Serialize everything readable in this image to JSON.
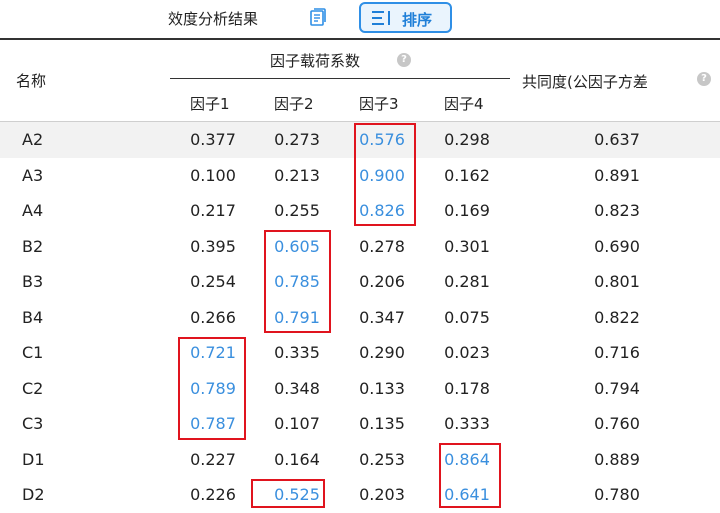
{
  "toolbar": {
    "title": "效度分析结果",
    "copy_icon": "document-copy-icon",
    "sort_label": "排序",
    "sort_icon": "sort-icon"
  },
  "table": {
    "header": {
      "name": "名称",
      "loadings_group": "因子载荷系数",
      "factors": [
        "因子1",
        "因子2",
        "因子3",
        "因子4"
      ],
      "communality": "共同度(公因子方差",
      "help_mark": "?"
    },
    "rows": [
      {
        "name": "A2",
        "values": [
          "0.377",
          "0.273",
          "0.576",
          "0.298",
          "0.637"
        ]
      },
      {
        "name": "A3",
        "values": [
          "0.100",
          "0.213",
          "0.900",
          "0.162",
          "0.891"
        ]
      },
      {
        "name": "A4",
        "values": [
          "0.217",
          "0.255",
          "0.826",
          "0.169",
          "0.823"
        ]
      },
      {
        "name": "B2",
        "values": [
          "0.395",
          "0.605",
          "0.278",
          "0.301",
          "0.690"
        ]
      },
      {
        "name": "B3",
        "values": [
          "0.254",
          "0.785",
          "0.206",
          "0.281",
          "0.801"
        ]
      },
      {
        "name": "B4",
        "values": [
          "0.266",
          "0.791",
          "0.347",
          "0.075",
          "0.822"
        ]
      },
      {
        "name": "C1",
        "values": [
          "0.721",
          "0.335",
          "0.290",
          "0.023",
          "0.716"
        ]
      },
      {
        "name": "C2",
        "values": [
          "0.789",
          "0.348",
          "0.133",
          "0.178",
          "0.794"
        ]
      },
      {
        "name": "C3",
        "values": [
          "0.787",
          "0.107",
          "0.135",
          "0.333",
          "0.760"
        ]
      },
      {
        "name": "D1",
        "values": [
          "0.227",
          "0.164",
          "0.253",
          "0.864",
          "0.889"
        ]
      },
      {
        "name": "D2",
        "values": [
          "0.226",
          "0.525",
          "0.203",
          "0.641",
          "0.780"
        ]
      }
    ],
    "highlight_color": "#3a8fde",
    "box_color": "#e0141e"
  }
}
